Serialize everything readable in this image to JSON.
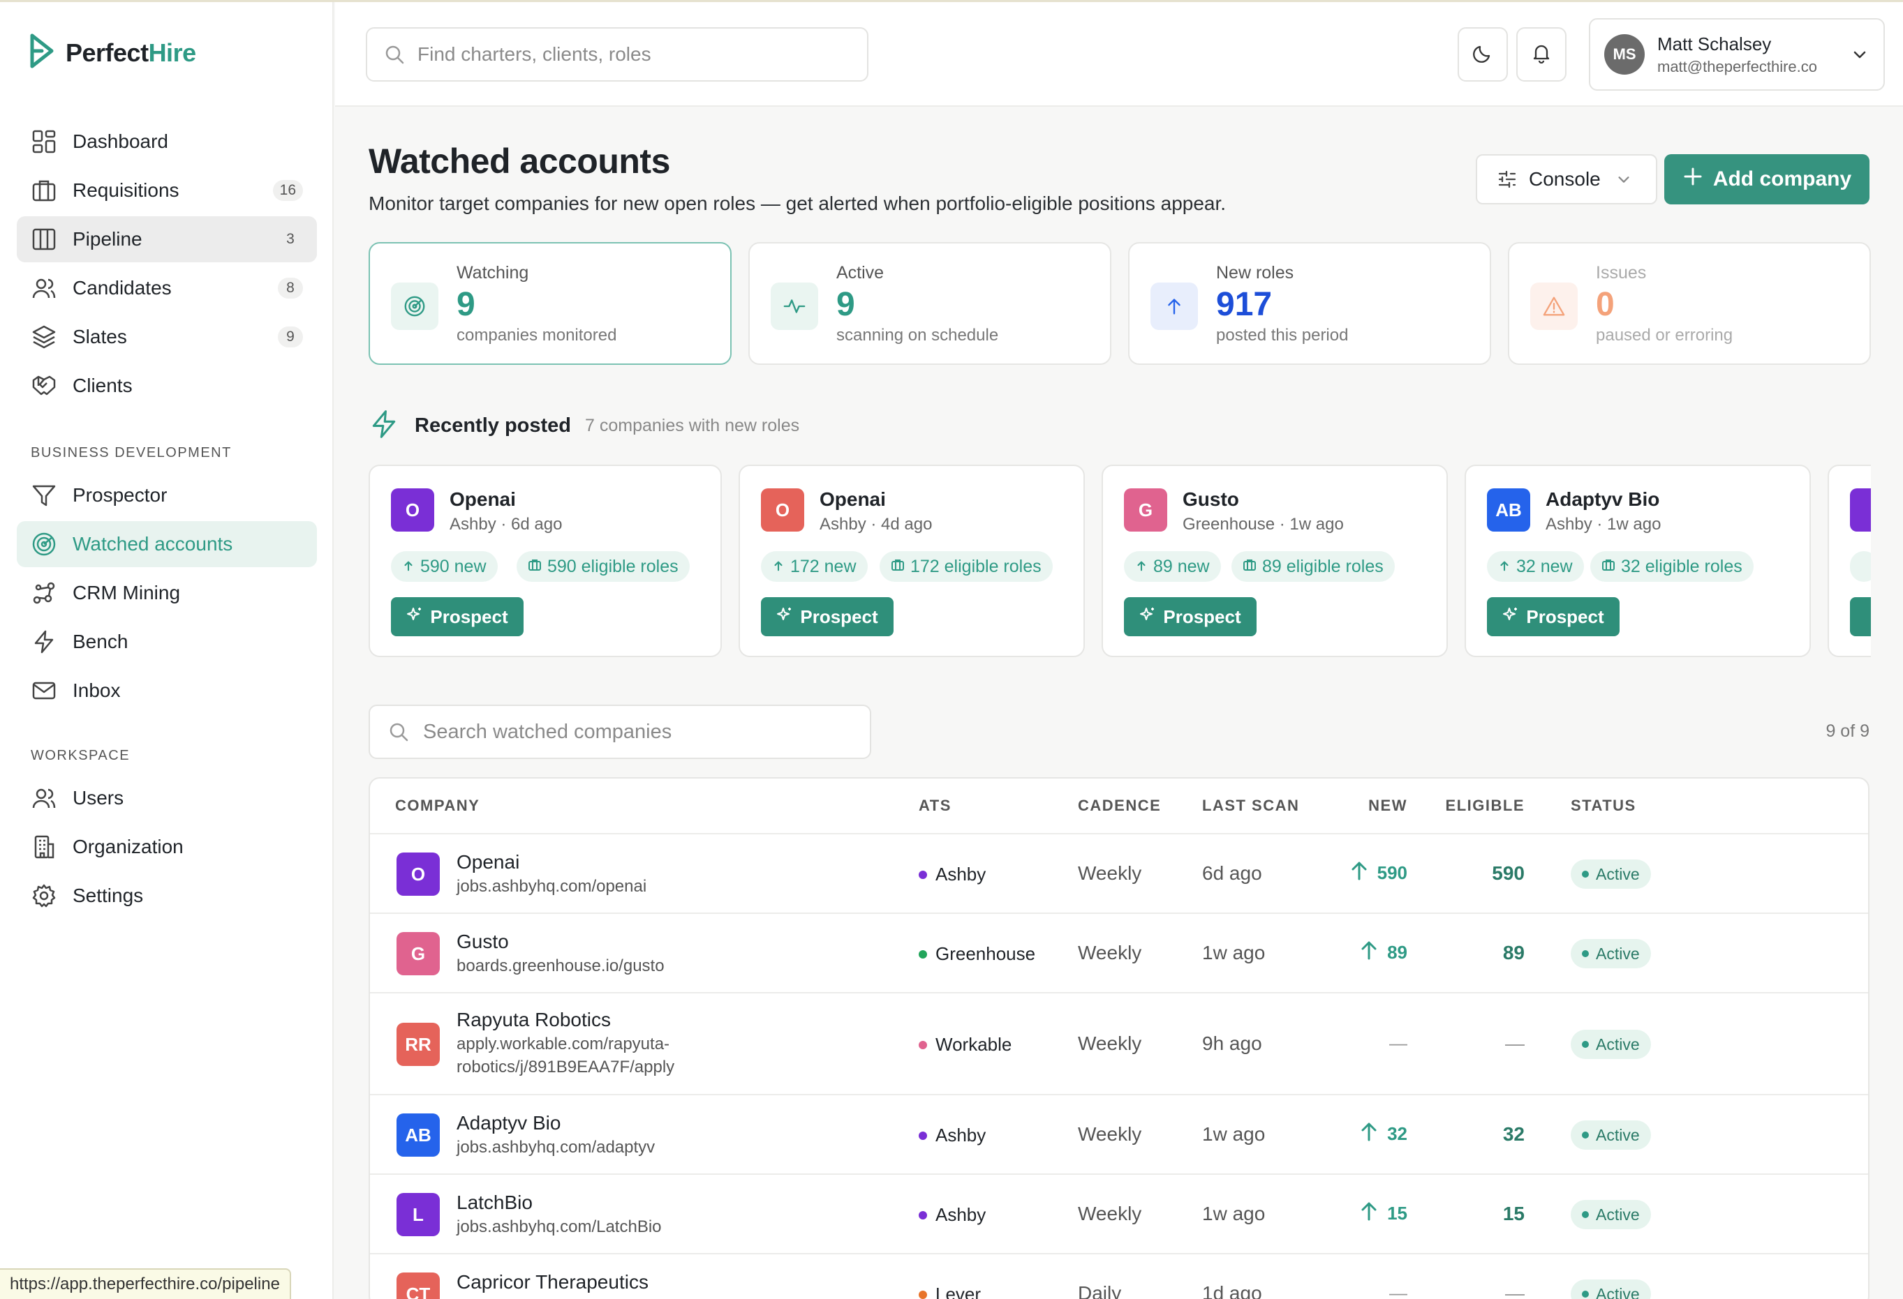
{
  "app": {
    "logo_main": "Perfect",
    "logo_accent": "Hire",
    "brand_color": "#2e9a85"
  },
  "sidebar": {
    "items": [
      {
        "label": "Dashboard",
        "icon": "dashboard-icon"
      },
      {
        "label": "Requisitions",
        "icon": "briefcase-icon",
        "badge": "16"
      },
      {
        "label": "Pipeline",
        "icon": "columns-icon",
        "badge": "3"
      },
      {
        "label": "Candidates",
        "icon": "users-icon",
        "badge": "8"
      },
      {
        "label": "Slates",
        "icon": "layers-icon",
        "badge": "9"
      },
      {
        "label": "Clients",
        "icon": "handshake-icon"
      }
    ],
    "bd_label": "BUSINESS DEVELOPMENT",
    "bd_items": [
      {
        "label": "Prospector",
        "icon": "filter-icon"
      },
      {
        "label": "Watched accounts",
        "icon": "radar-icon"
      },
      {
        "label": "CRM Mining",
        "icon": "graph-icon"
      },
      {
        "label": "Bench",
        "icon": "lightning-icon"
      },
      {
        "label": "Inbox",
        "icon": "mail-icon"
      }
    ],
    "ws_label": "WORKSPACE",
    "ws_items": [
      {
        "label": "Users",
        "icon": "users-icon"
      },
      {
        "label": "Organization",
        "icon": "building-icon"
      },
      {
        "label": "Settings",
        "icon": "gear-icon"
      }
    ]
  },
  "statusbar": {
    "url": "https://app.theperfecthire.co/pipeline"
  },
  "header": {
    "search_placeholder": "Find charters, clients, roles",
    "user": {
      "initials": "MS",
      "name": "Matt Schalsey",
      "email": "matt@theperfecthire.co"
    }
  },
  "page": {
    "title": "Watched accounts",
    "subtitle": "Monitor target companies for new open roles — get alerted when portfolio-eligible positions appear.",
    "console_label": "Console",
    "add_label": "Add company"
  },
  "stats": [
    {
      "label": "Watching",
      "value": "9",
      "desc": "companies monitored",
      "color": "#2e9a85"
    },
    {
      "label": "Active",
      "value": "9",
      "desc": "scanning on schedule",
      "color": "#2e9a85"
    },
    {
      "label": "New roles",
      "value": "917",
      "desc": "posted this period",
      "color": "#2563eb"
    },
    {
      "label": "Issues",
      "value": "0",
      "desc": "paused or erroring",
      "color": "#f4a27a"
    }
  ],
  "recent": {
    "title": "Recently posted",
    "subtitle": "7 companies with new roles",
    "cards": [
      {
        "initials": "O",
        "name": "Openai",
        "ats": "Ashby",
        "ago": "6d ago",
        "new": "590 new",
        "eligible": "590 eligible roles",
        "color": "#7a2fd6"
      },
      {
        "initials": "O",
        "name": "Openai",
        "ats": "Ashby",
        "ago": "4d ago",
        "new": "172 new",
        "eligible": "172 eligible roles",
        "color": "#e5635a"
      },
      {
        "initials": "G",
        "name": "Gusto",
        "ats": "Greenhouse",
        "ago": "1w ago",
        "new": "89 new",
        "eligible": "89 eligible roles",
        "color": "#e0638f"
      },
      {
        "initials": "AB",
        "name": "Adaptyv Bio",
        "ats": "Ashby",
        "ago": "1w ago",
        "new": "32 new",
        "eligible": "32 eligible roles",
        "color": "#2563eb"
      }
    ],
    "prospect_label": "Prospect"
  },
  "watch": {
    "search_placeholder": "Search watched companies",
    "count": "9 of 9"
  },
  "table": {
    "headers": {
      "company": "COMPANY",
      "ats": "ATS",
      "cadence": "CADENCE",
      "last_scan": "LAST SCAN",
      "new": "NEW",
      "eligible": "ELIGIBLE",
      "status": "STATUS"
    },
    "rows": [
      {
        "initials": "O",
        "name": "Openai",
        "url": "jobs.ashbyhq.com/openai",
        "ats": "Ashby",
        "ats_color": "#7a2fd6",
        "cadence": "Weekly",
        "scan": "6d ago",
        "new": "590",
        "eligible": "590",
        "status": "Active",
        "color": "#7a2fd6"
      },
      {
        "initials": "G",
        "name": "Gusto",
        "url": "boards.greenhouse.io/gusto",
        "ats": "Greenhouse",
        "ats_color": "#22a55b",
        "cadence": "Weekly",
        "scan": "1w ago",
        "new": "89",
        "eligible": "89",
        "status": "Active",
        "color": "#e0638f"
      },
      {
        "initials": "RR",
        "name": "Rapyuta Robotics",
        "url": "apply.workable.com/rapyuta-robotics/j/891B9EAA7F/apply",
        "ats": "Workable",
        "ats_color": "#e0638f",
        "cadence": "Weekly",
        "scan": "9h ago",
        "new": "—",
        "eligible": "—",
        "status": "Active",
        "color": "#e5635a"
      },
      {
        "initials": "AB",
        "name": "Adaptyv Bio",
        "url": "jobs.ashbyhq.com/adaptyv",
        "ats": "Ashby",
        "ats_color": "#7a2fd6",
        "cadence": "Weekly",
        "scan": "1w ago",
        "new": "32",
        "eligible": "32",
        "status": "Active",
        "color": "#2563eb"
      },
      {
        "initials": "L",
        "name": "LatchBio",
        "url": "jobs.ashbyhq.com/LatchBio",
        "ats": "Ashby",
        "ats_color": "#7a2fd6",
        "cadence": "Weekly",
        "scan": "1w ago",
        "new": "15",
        "eligible": "15",
        "status": "Active",
        "color": "#7a2fd6"
      },
      {
        "initials": "CT",
        "name": "Capricor Therapeutics",
        "url": "",
        "ats": "Lever",
        "ats_color": "#e8742a",
        "cadence": "Daily",
        "scan": "1d ago",
        "new": "—",
        "eligible": "—",
        "status": "Active",
        "color": "#e5635a"
      }
    ]
  }
}
